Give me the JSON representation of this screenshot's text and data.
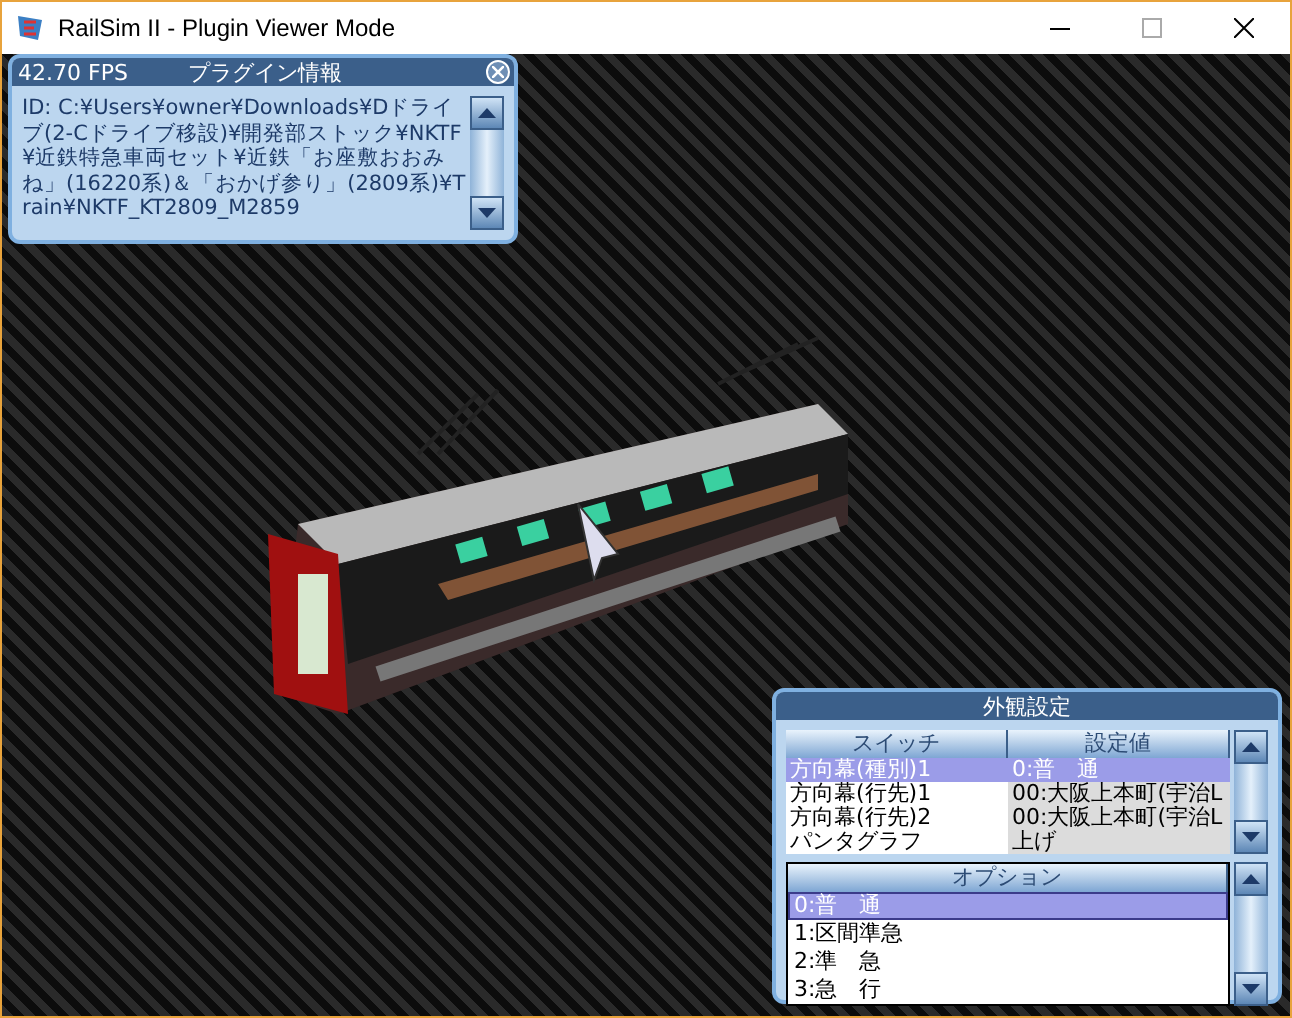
{
  "window": {
    "title": "RailSim II - Plugin Viewer Mode"
  },
  "plugin_info": {
    "fps": "42.70 FPS",
    "title": "プラグイン情報",
    "text": "ID: C:¥Users¥owner¥Downloads¥Dドライブ(2-Cドライブ移設)¥開発部ストック¥NKTF¥近鉄特急車両セット¥近鉄「お座敷おおみね」(16220系)＆「おかげ参り」(2809系)¥Train¥NKTF_KT2809_M2859"
  },
  "appearance": {
    "title": "外観設定",
    "columns": [
      "スイッチ",
      "設定値"
    ],
    "switches": [
      {
        "name": "方向幕(種別)1",
        "value": "0:普　通",
        "selected": true
      },
      {
        "name": "方向幕(行先)1",
        "value": "00:大阪上本町(宇治L",
        "selected": false
      },
      {
        "name": "方向幕(行先)2",
        "value": "00:大阪上本町(宇治L",
        "selected": false
      },
      {
        "name": "パンタグラフ",
        "value": "上げ",
        "selected": false
      }
    ],
    "options_header": "オプション",
    "options": [
      {
        "label": "0:普　通",
        "selected": true
      },
      {
        "label": "1:区間準急",
        "selected": false
      },
      {
        "label": "2:準　急",
        "selected": false
      },
      {
        "label": "3:急　行",
        "selected": false
      }
    ]
  }
}
